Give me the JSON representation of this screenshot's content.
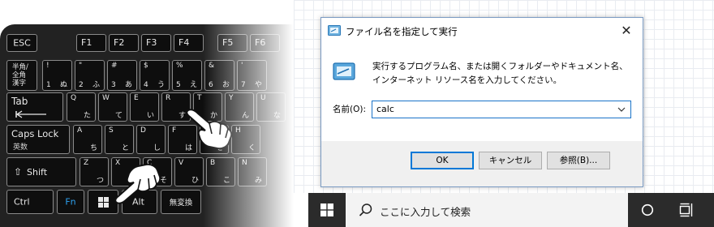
{
  "keyboard": {
    "row1": [
      {
        "id": "esc",
        "label": "ESC"
      },
      {
        "id": "f1",
        "label": "F1"
      },
      {
        "id": "f2",
        "label": "F2"
      },
      {
        "id": "f3",
        "label": "F3"
      },
      {
        "id": "f4",
        "label": "F4"
      },
      {
        "id": "f5",
        "label": "F5"
      },
      {
        "id": "f6",
        "label": "F6"
      }
    ],
    "hankaku": {
      "l1": "半角/",
      "l2": "全角",
      "l3": "漢字"
    },
    "num_keys": [
      {
        "sym": "!",
        "num": "1",
        "kana": "ぬ"
      },
      {
        "sym": "\"",
        "num": "2",
        "kana": "ふ"
      },
      {
        "sym": "#",
        "num": "3",
        "kana": "あ"
      },
      {
        "sym": "$",
        "num": "4",
        "kana": "う"
      },
      {
        "sym": "%",
        "num": "5",
        "kana": "え"
      },
      {
        "sym": "&",
        "num": "6",
        "kana": "お"
      },
      {
        "sym": "'",
        "num": "7",
        "kana": "や"
      }
    ],
    "tab": "Tab",
    "q_row": [
      {
        "letter": "Q",
        "kana": "た"
      },
      {
        "letter": "W",
        "kana": "て"
      },
      {
        "letter": "E",
        "kana": "い"
      },
      {
        "letter": "R",
        "kana": "す"
      },
      {
        "letter": "T",
        "kana": "か"
      },
      {
        "letter": "Y",
        "kana": "ん"
      },
      {
        "letter": "U",
        "kana": "な"
      }
    ],
    "caps": {
      "l1": "Caps Lock",
      "l2": "英数"
    },
    "a_row": [
      {
        "letter": "A",
        "kana": "ち"
      },
      {
        "letter": "S",
        "kana": "と"
      },
      {
        "letter": "D",
        "kana": "し"
      },
      {
        "letter": "F",
        "kana": "は"
      },
      {
        "letter": "G",
        "kana": "き"
      },
      {
        "letter": "H",
        "kana": "く"
      }
    ],
    "shift": "Shift",
    "z_row": [
      {
        "letter": "Z",
        "kana": "つ"
      },
      {
        "letter": "X",
        "kana": "さ"
      },
      {
        "letter": "C",
        "kana": "そ"
      },
      {
        "letter": "V",
        "kana": "ひ"
      },
      {
        "letter": "B",
        "kana": "こ"
      },
      {
        "letter": "N",
        "kana": "み"
      }
    ],
    "ctrl": "Ctrl",
    "fn": "Fn",
    "alt": "Alt",
    "muhenkan": "無変換"
  },
  "dialog": {
    "title": "ファイル名を指定して実行",
    "close": "✕",
    "description": "実行するプログラム名、または開くフォルダーやドキュメント名、インターネット リソース名を入力してください。",
    "open_label": "名前(O):",
    "open_value": "calc",
    "ok": "OK",
    "cancel": "キャンセル",
    "browse": "参照(B)..."
  },
  "taskbar": {
    "search_placeholder": "ここに入力して検索"
  },
  "colors": {
    "accent": "#0078d7",
    "taskbar": "#2b2b2b",
    "keyboard": "#222222"
  }
}
